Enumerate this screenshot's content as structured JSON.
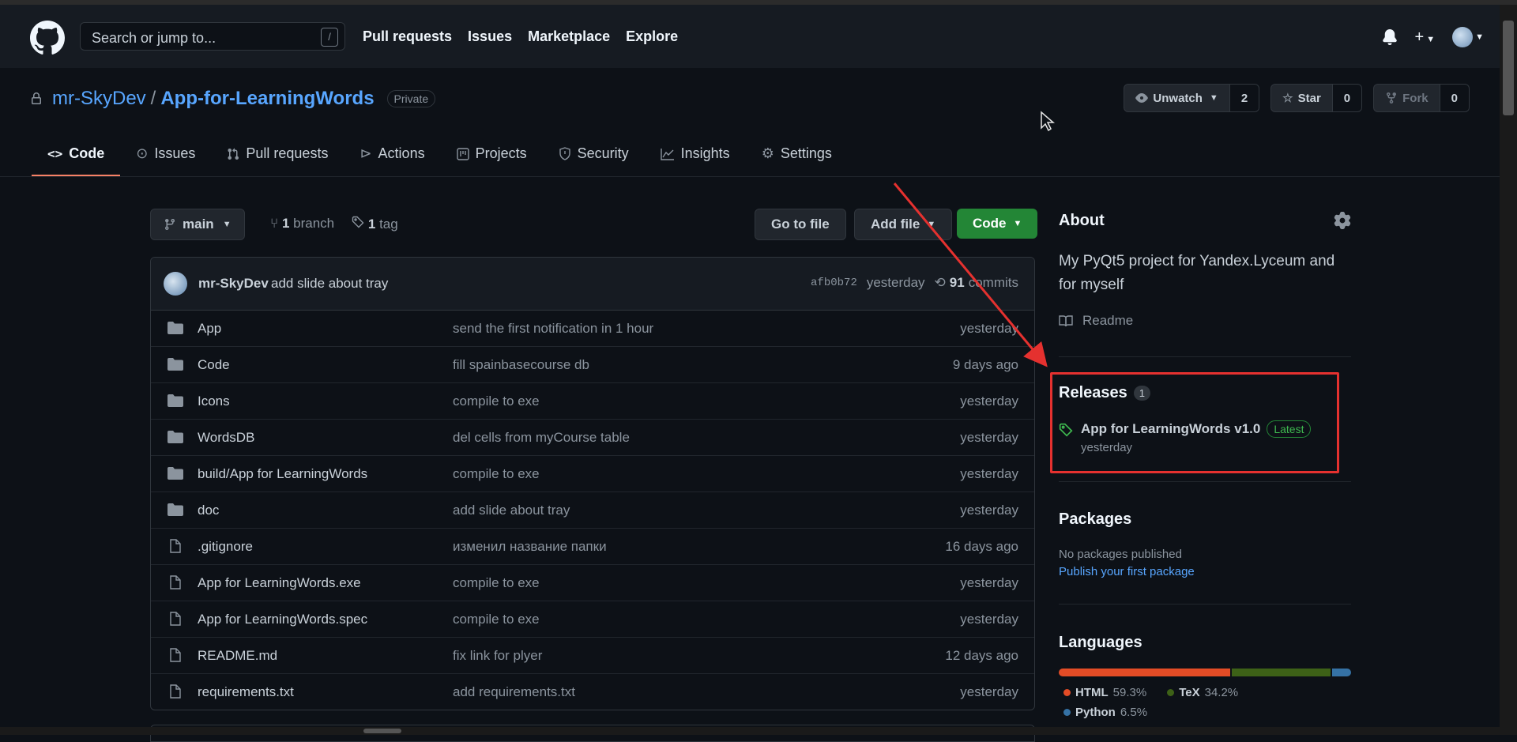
{
  "header": {
    "search_placeholder": "Search or jump to...",
    "search_shortcut": "/",
    "nav": [
      "Pull requests",
      "Issues",
      "Marketplace",
      "Explore"
    ],
    "plus_label": "+"
  },
  "repo": {
    "owner": "mr-SkyDev",
    "separator": "/",
    "name": "App-for-LearningWords",
    "visibility": "Private",
    "watch_label": "Unwatch",
    "watch_count": "2",
    "star_label": "Star",
    "star_count": "0",
    "fork_label": "Fork",
    "fork_count": "0"
  },
  "tabs": [
    "Code",
    "Issues",
    "Pull requests",
    "Actions",
    "Projects",
    "Security",
    "Insights",
    "Settings"
  ],
  "toolbar": {
    "branch": "main",
    "branch_count": "1",
    "branch_label": "branch",
    "tag_count": "1",
    "tag_label": "tag",
    "go_to_file": "Go to file",
    "add_file": "Add file",
    "code": "Code"
  },
  "latest_commit": {
    "author": "mr-SkyDev",
    "message": "add slide about tray",
    "sha": "afb0b72",
    "time": "yesterday",
    "commit_count": "91",
    "commit_label": "commits"
  },
  "files": [
    {
      "type": "dir",
      "name": "App",
      "message": "send the first notification in 1 hour",
      "age": "yesterday"
    },
    {
      "type": "dir",
      "name": "Code",
      "message": "fill spainbasecourse db",
      "age": "9 days ago"
    },
    {
      "type": "dir",
      "name": "Icons",
      "message": "compile to exe",
      "age": "yesterday"
    },
    {
      "type": "dir",
      "name": "WordsDB",
      "message": "del cells from myCourse table",
      "age": "yesterday"
    },
    {
      "type": "dir",
      "name": "build/App for LearningWords",
      "message": "compile to exe",
      "age": "yesterday"
    },
    {
      "type": "dir",
      "name": "doc",
      "message": "add slide about tray",
      "age": "yesterday"
    },
    {
      "type": "file",
      "name": ".gitignore",
      "message": "изменил название папки",
      "age": "16 days ago"
    },
    {
      "type": "file",
      "name": "App for LearningWords.exe",
      "message": "compile to exe",
      "age": "yesterday"
    },
    {
      "type": "file",
      "name": "App for LearningWords.spec",
      "message": "compile to exe",
      "age": "yesterday"
    },
    {
      "type": "file",
      "name": "README.md",
      "message": "fix link for plyer",
      "age": "12 days ago"
    },
    {
      "type": "file",
      "name": "requirements.txt",
      "message": "add requirements.txt",
      "age": "yesterday"
    }
  ],
  "about": {
    "title": "About",
    "description": "My PyQt5 project for Yandex.Lyceum and for myself",
    "readme": "Readme"
  },
  "releases": {
    "title": "Releases",
    "count": "1",
    "latest_name": "App for LearningWords v1.0",
    "latest_badge": "Latest",
    "latest_date": "yesterday"
  },
  "packages": {
    "title": "Packages",
    "none_text": "No packages published",
    "publish_link": "Publish your first package"
  },
  "languages": {
    "title": "Languages",
    "items": [
      {
        "name": "HTML",
        "percent": "59.3%",
        "value": 59.3,
        "color": "#e34c26"
      },
      {
        "name": "TeX",
        "percent": "34.2%",
        "value": 34.2,
        "color": "#3d6117"
      },
      {
        "name": "Python",
        "percent": "6.5%",
        "value": 6.5,
        "color": "#3572A5"
      }
    ]
  },
  "colors": {
    "accent": "#58a6ff",
    "code_button": "#238636",
    "highlight": "#e5312f",
    "tab_underline": "#f78166"
  }
}
